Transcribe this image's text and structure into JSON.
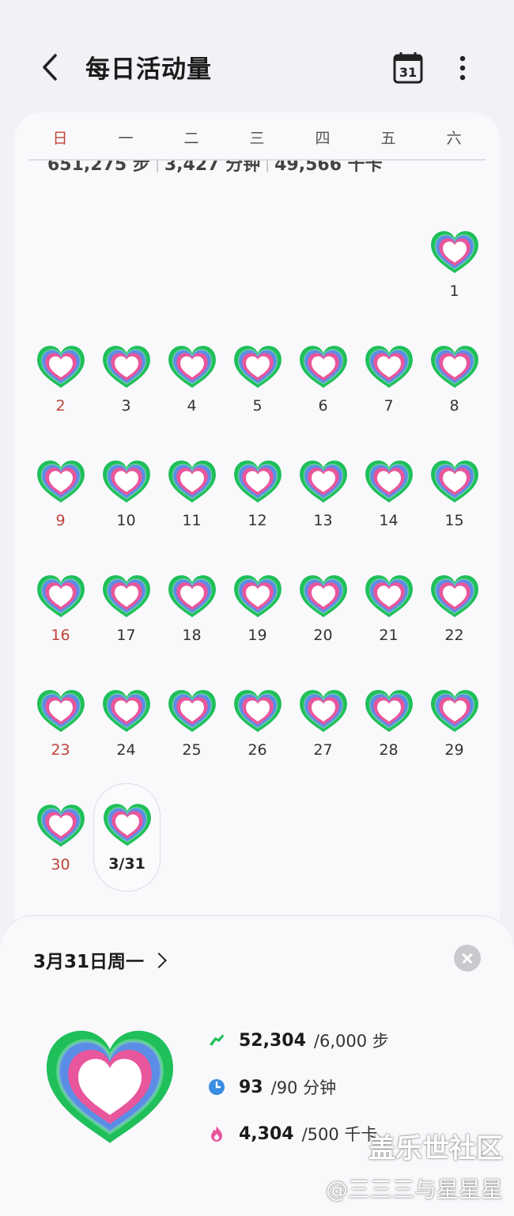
{
  "header": {
    "title": "每日活动量",
    "calendar_label": "31"
  },
  "weekdays": [
    "日",
    "一",
    "二",
    "三",
    "四",
    "五",
    "六"
  ],
  "summary": {
    "steps": "651,275 步",
    "minutes": "3,427 分钟",
    "calories": "49,566 千卡"
  },
  "days": [
    {
      "label": "1",
      "col": 6,
      "row": 0
    },
    {
      "label": "2",
      "col": 0,
      "row": 1
    },
    {
      "label": "3",
      "col": 1,
      "row": 1
    },
    {
      "label": "4",
      "col": 2,
      "row": 1
    },
    {
      "label": "5",
      "col": 3,
      "row": 1
    },
    {
      "label": "6",
      "col": 4,
      "row": 1
    },
    {
      "label": "7",
      "col": 5,
      "row": 1
    },
    {
      "label": "8",
      "col": 6,
      "row": 1
    },
    {
      "label": "9",
      "col": 0,
      "row": 2
    },
    {
      "label": "10",
      "col": 1,
      "row": 2
    },
    {
      "label": "11",
      "col": 2,
      "row": 2
    },
    {
      "label": "12",
      "col": 3,
      "row": 2
    },
    {
      "label": "13",
      "col": 4,
      "row": 2
    },
    {
      "label": "14",
      "col": 5,
      "row": 2
    },
    {
      "label": "15",
      "col": 6,
      "row": 2
    },
    {
      "label": "16",
      "col": 0,
      "row": 3
    },
    {
      "label": "17",
      "col": 1,
      "row": 3
    },
    {
      "label": "18",
      "col": 2,
      "row": 3
    },
    {
      "label": "19",
      "col": 3,
      "row": 3
    },
    {
      "label": "20",
      "col": 4,
      "row": 3
    },
    {
      "label": "21",
      "col": 5,
      "row": 3
    },
    {
      "label": "22",
      "col": 6,
      "row": 3
    },
    {
      "label": "23",
      "col": 0,
      "row": 4
    },
    {
      "label": "24",
      "col": 1,
      "row": 4
    },
    {
      "label": "25",
      "col": 2,
      "row": 4
    },
    {
      "label": "26",
      "col": 3,
      "row": 4
    },
    {
      "label": "27",
      "col": 4,
      "row": 4
    },
    {
      "label": "28",
      "col": 5,
      "row": 4
    },
    {
      "label": "29",
      "col": 6,
      "row": 4
    },
    {
      "label": "30",
      "col": 0,
      "row": 5
    },
    {
      "label": "3/31",
      "col": 1,
      "row": 5,
      "today": true
    }
  ],
  "detail": {
    "date": "3月31日周一",
    "stats": [
      {
        "icon": "steps-icon",
        "value": "52,304",
        "goal": "/6,000 步",
        "color": "#1fbf5a"
      },
      {
        "icon": "clock-icon",
        "value": "93",
        "goal": "/90 分钟",
        "color": "#3a8de0"
      },
      {
        "icon": "flame-icon",
        "value": "4,304",
        "goal": "/500 千卡",
        "color": "#e8569c"
      }
    ]
  },
  "watermark": {
    "line1": "盖乐世社区",
    "line2": "@三三三与星星星"
  },
  "colors": {
    "green": "#1fbf5a",
    "blue": "#5b8de6",
    "pink": "#e8569c",
    "sunday": "#c0443a"
  }
}
